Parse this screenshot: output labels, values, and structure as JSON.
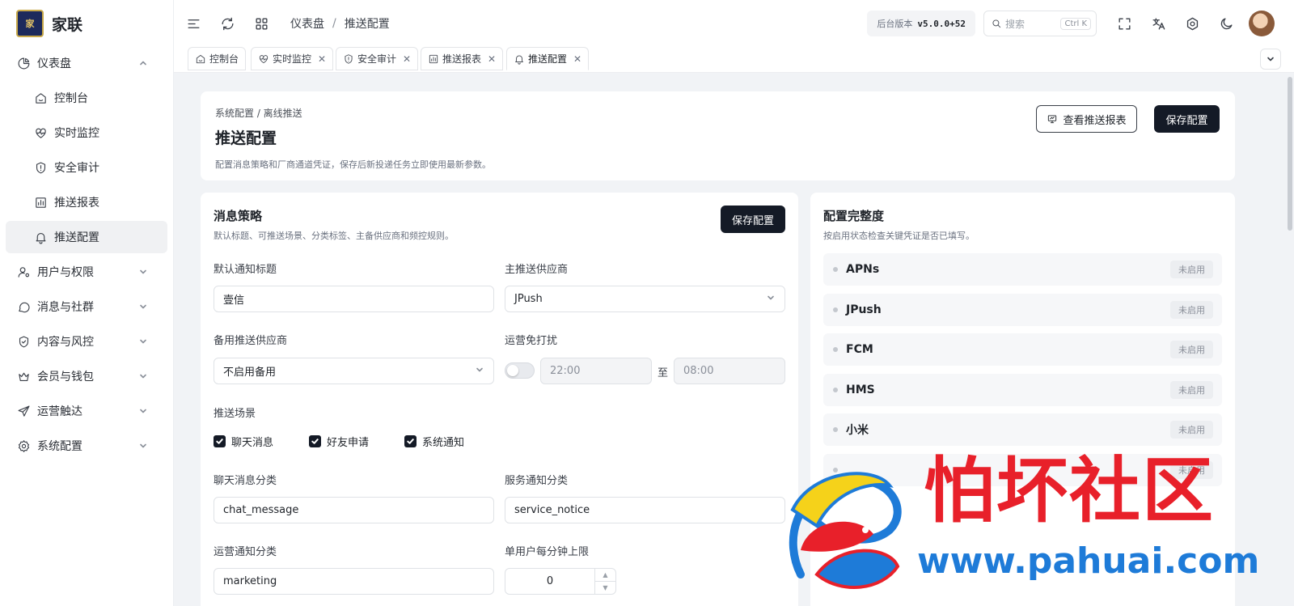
{
  "brand": {
    "name": "家联",
    "logo_text": "家"
  },
  "sidebar": {
    "items": [
      {
        "label": "仪表盘",
        "icon": "pie-chart-icon",
        "expanded": true
      },
      {
        "label": "控制台",
        "icon": "home-icon"
      },
      {
        "label": "实时监控",
        "icon": "heart-pulse-icon"
      },
      {
        "label": "安全审计",
        "icon": "shield-alert-icon"
      },
      {
        "label": "推送报表",
        "icon": "bar-chart-icon"
      },
      {
        "label": "推送配置",
        "icon": "bell-icon",
        "active": true
      },
      {
        "label": "用户与权限",
        "icon": "user-cog-icon"
      },
      {
        "label": "消息与社群",
        "icon": "message-circle-icon"
      },
      {
        "label": "内容与风控",
        "icon": "shield-check-icon"
      },
      {
        "label": "会员与钱包",
        "icon": "crown-icon"
      },
      {
        "label": "运营触达",
        "icon": "send-icon"
      },
      {
        "label": "系统配置",
        "icon": "settings-icon"
      }
    ]
  },
  "header": {
    "breadcrumb": [
      "仪表盘",
      "推送配置"
    ],
    "version_label": "后台版本",
    "version_value": "v5.0.0+52",
    "search_placeholder": "搜索",
    "search_kbd": "Ctrl K"
  },
  "tabs": [
    {
      "label": "控制台",
      "icon": "home-icon",
      "closable": false
    },
    {
      "label": "实时监控",
      "icon": "heart-pulse-icon",
      "closable": true
    },
    {
      "label": "安全审计",
      "icon": "shield-alert-icon",
      "closable": true
    },
    {
      "label": "推送报表",
      "icon": "bar-chart-icon",
      "closable": true
    },
    {
      "label": "推送配置",
      "icon": "bell-icon",
      "closable": true,
      "active": true
    }
  ],
  "page": {
    "breadcrumb": "系统配置 / 离线推送",
    "title": "推送配置",
    "description": "配置消息策略和厂商通道凭证，保存后新投递任务立即使用最新参数。",
    "view_report_label": "查看推送报表",
    "save_label": "保存配置"
  },
  "strategy": {
    "title": "消息策略",
    "description": "默认标题、可推送场景、分类标签、主备供应商和频控规则。",
    "save_label": "保存配置",
    "default_title_label": "默认通知标题",
    "default_title_value": "壹信",
    "primary_provider_label": "主推送供应商",
    "primary_provider_value": "JPush",
    "backup_provider_label": "备用推送供应商",
    "backup_provider_value": "不启用备用",
    "dnd_label": "运营免打扰",
    "dnd_enabled": false,
    "dnd_start": "22:00",
    "dnd_to": "至",
    "dnd_end": "08:00",
    "scenes_label": "推送场景",
    "scenes": [
      {
        "label": "聊天消息",
        "checked": true
      },
      {
        "label": "好友申请",
        "checked": true
      },
      {
        "label": "系统通知",
        "checked": true
      }
    ],
    "chat_category_label": "聊天消息分类",
    "chat_category_value": "chat_message",
    "service_category_label": "服务通知分类",
    "service_category_value": "service_notice",
    "ops_category_label": "运营通知分类",
    "ops_category_value": "marketing",
    "rate_limit_label": "单用户每分钟上限",
    "rate_limit_value": "0"
  },
  "completeness": {
    "title": "配置完整度",
    "description": "按启用状态检查关键凭证是否已填写。",
    "providers": [
      {
        "name": "APNs",
        "status": "未启用"
      },
      {
        "name": "JPush",
        "status": "未启用"
      },
      {
        "name": "FCM",
        "status": "未启用"
      },
      {
        "name": "HMS",
        "status": "未启用"
      },
      {
        "name": "小米",
        "status": "未启用"
      },
      {
        "name": "",
        "status": "未启用"
      }
    ]
  },
  "watermark": {
    "text": "怕坏社区",
    "url": "www.pahuai.com"
  },
  "colors": {
    "primary_dark": "#141a26",
    "active_nav_bg": "#f0f1f3",
    "page_bg": "#f1f3f6",
    "watermark_red": "#e8202a",
    "watermark_blue": "#1e7bd8"
  }
}
